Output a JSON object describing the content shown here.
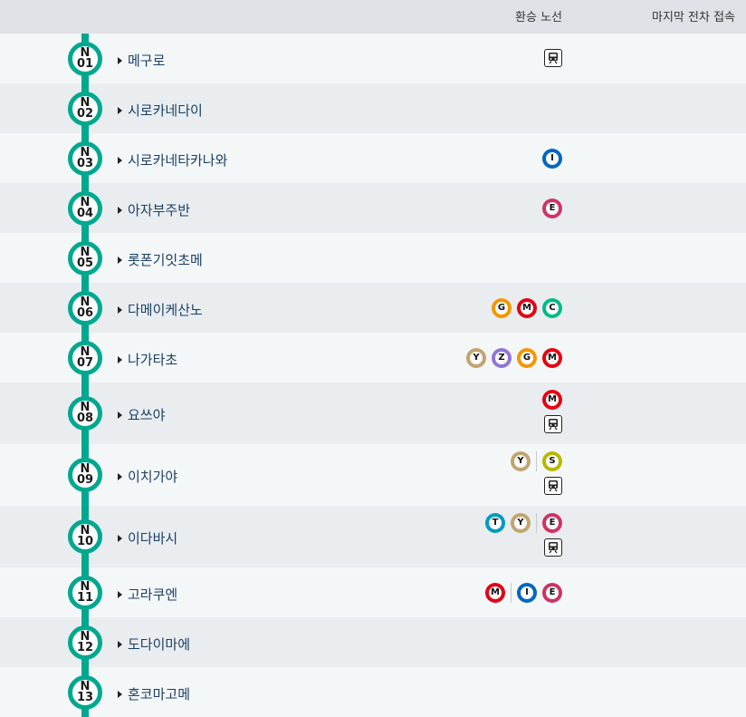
{
  "header": {
    "transfer_label": "환승 노선",
    "last_train_label": "마지막 전차 접속"
  },
  "colors": {
    "line": "#00a88f",
    "G": "#f39700",
    "M": "#e60012",
    "C": "#00bb85",
    "Y": "#c1a470",
    "Z": "#8f76d6",
    "I": "#0067c0",
    "E": "#cf3366",
    "S": "#b5b900",
    "T": "#009bbf"
  },
  "stations": [
    {
      "line": "N",
      "num": "01",
      "name": "메구로",
      "transfer_rows": [
        [
          "rail"
        ]
      ]
    },
    {
      "line": "N",
      "num": "02",
      "name": "시로카네다이",
      "transfer_rows": []
    },
    {
      "line": "N",
      "num": "03",
      "name": "시로카네타카나와",
      "transfer_rows": [
        [
          "I"
        ]
      ]
    },
    {
      "line": "N",
      "num": "04",
      "name": "아자부주반",
      "transfer_rows": [
        [
          "E"
        ]
      ]
    },
    {
      "line": "N",
      "num": "05",
      "name": "롯폰기잇초메",
      "transfer_rows": []
    },
    {
      "line": "N",
      "num": "06",
      "name": "다메이케산노",
      "transfer_rows": [
        [
          "G",
          "M",
          "C"
        ]
      ]
    },
    {
      "line": "N",
      "num": "07",
      "name": "나가타초",
      "transfer_rows": [
        [
          "Y",
          "Z",
          "G",
          "M"
        ]
      ]
    },
    {
      "line": "N",
      "num": "08",
      "name": "요쓰야",
      "transfer_rows": [
        [
          "M"
        ],
        [
          "rail"
        ]
      ]
    },
    {
      "line": "N",
      "num": "09",
      "name": "이치가야",
      "transfer_rows": [
        [
          "Y",
          "|",
          "S"
        ],
        [
          "rail"
        ]
      ]
    },
    {
      "line": "N",
      "num": "10",
      "name": "이다바시",
      "transfer_rows": [
        [
          "T",
          "Y",
          "|",
          "E"
        ],
        [
          "rail"
        ]
      ]
    },
    {
      "line": "N",
      "num": "11",
      "name": "고라쿠엔",
      "transfer_rows": [
        [
          "M",
          "|",
          "I",
          "E"
        ]
      ]
    },
    {
      "line": "N",
      "num": "12",
      "name": "도다이마에",
      "transfer_rows": []
    },
    {
      "line": "N",
      "num": "13",
      "name": "혼코마고메",
      "transfer_rows": []
    }
  ]
}
